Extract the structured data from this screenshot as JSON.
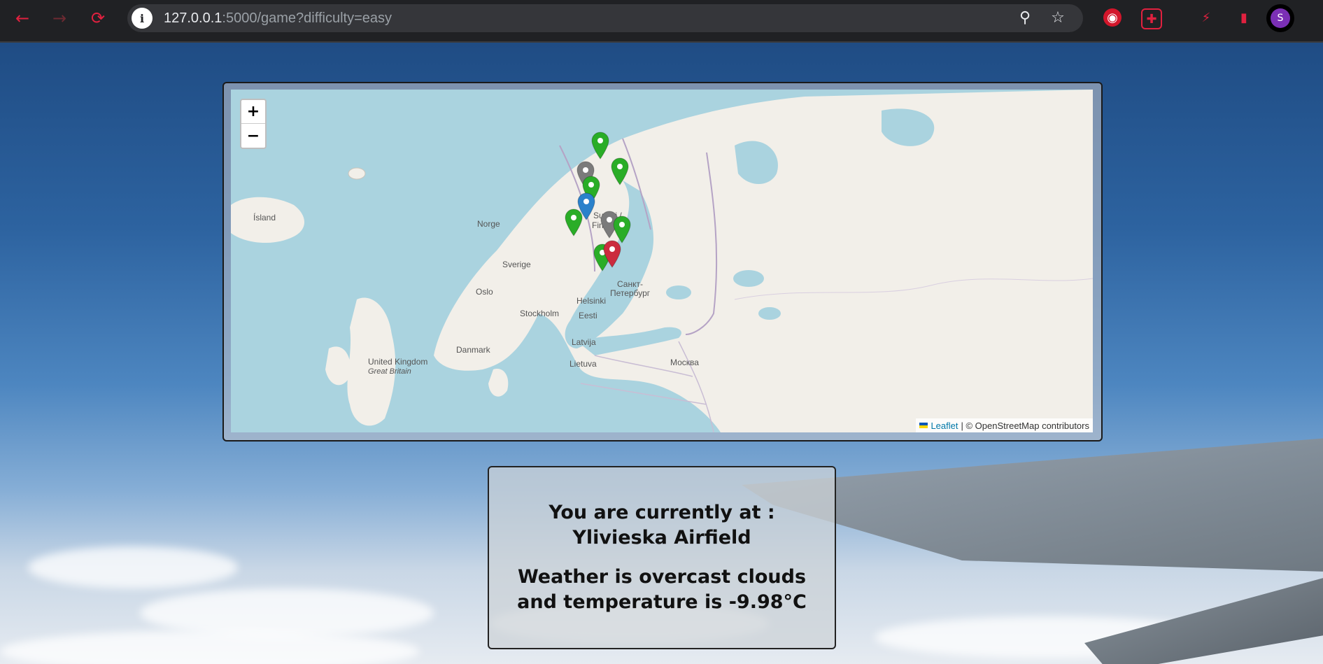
{
  "browser": {
    "url_host": "127.0.0.1",
    "url_rest": ":5000/game?difficulty=easy",
    "profile_initial": "S",
    "icons": [
      "back-icon",
      "forward-icon",
      "reload-icon",
      "site-info-icon",
      "zoom-icon",
      "bookmark-star-icon",
      "extension-icons",
      "profile-avatar"
    ]
  },
  "map": {
    "zoom_in": "+",
    "zoom_out": "−",
    "attribution_link": "Leaflet",
    "attribution_text": "| © OpenStreetMap contributors",
    "labels": {
      "island": "Ísland",
      "norge": "Norge",
      "sverige": "Sverige",
      "suomi": "Suomi /",
      "finland": "Finland",
      "oslo": "Oslo",
      "stockholm": "Stockholm",
      "helsinki": "Helsinki",
      "spb1": "Санкт-",
      "spb2": "Петербург",
      "eesti": "Eesti",
      "latvija": "Latvija",
      "danmark": "Danmark",
      "lietuva": "Lietuva",
      "moskva": "Москва",
      "uk": "United Kingdom",
      "gb": "Great Britain"
    },
    "marker_colors": {
      "green": "#2aad27",
      "grey": "#7b7b7b",
      "blue": "#2a81cb",
      "red": "#cb2b3e"
    },
    "markers": [
      {
        "color": "green"
      },
      {
        "color": "green"
      },
      {
        "color": "grey"
      },
      {
        "color": "green"
      },
      {
        "color": "blue"
      },
      {
        "color": "green"
      },
      {
        "color": "grey"
      },
      {
        "color": "green"
      },
      {
        "color": "green"
      },
      {
        "color": "red"
      }
    ]
  },
  "info": {
    "location": "You are currently at : Ylivieska Airfield",
    "weather": "Weather is overcast clouds and temperature is -9.98°C"
  }
}
